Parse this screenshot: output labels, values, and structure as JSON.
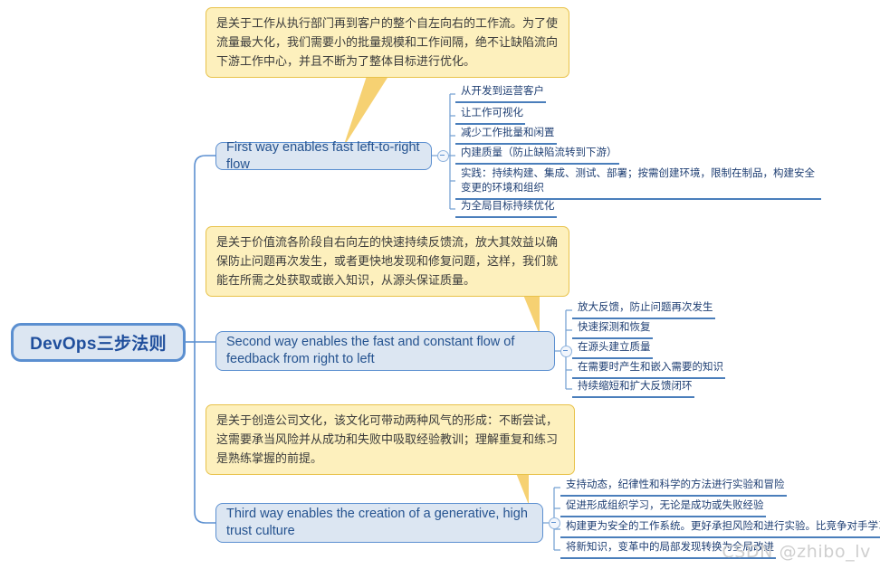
{
  "root": {
    "label": "DevOps三步法则"
  },
  "branches": [
    {
      "id": "first-way",
      "label": "First way enables fast left-to-right flow",
      "note": "是关于工作从执行部门再到客户的整个自左向右的工作流。为了使流量最大化，我们需要小的批量规模和工作间隔，绝不让缺陷流向下游工作中心，并且不断为了整体目标进行优化。",
      "leaves": [
        "从开发到运营客户",
        "让工作可视化",
        "减少工作批量和闲置",
        "内建质量（防止缺陷流转到下游）",
        "实践：持续构建、集成、测试、部署；按需创建环境，限制在制品，构建安全变更的环境和组织",
        "为全局目标持续优化"
      ]
    },
    {
      "id": "second-way",
      "label": "Second way enables the fast and constant flow of feedback from right to left",
      "note": "是关于价值流各阶段自右向左的快速持续反馈流，放大其效益以确保防止问题再次发生，或者更快地发现和修复问题，这样，我们就能在所需之处获取或嵌入知识，从源头保证质量。",
      "leaves": [
        "放大反馈，防止问题再次发生",
        "快速探测和恢复",
        "在源头建立质量",
        "在需要时产生和嵌入需要的知识",
        "持续缩短和扩大反馈闭环"
      ]
    },
    {
      "id": "third-way",
      "label": "Third way enables the creation of a generative, high trust culture",
      "note": "是关于创造公司文化，该文化可带动两种风气的形成：不断尝试，这需要承当风险并从成功和失败中吸取经验教训；理解重复和练习是熟练掌握的前提。",
      "leaves": [
        "支持动态，纪律性和科学的方法进行实验和冒险",
        "促进形成组织学习，无论是成功或失败经验",
        "构建更为安全的工作系统。更好承担风险和进行实验。比竞争对手学习更快",
        "将新知识，变革中的局部发现转换为全局改进"
      ]
    }
  ],
  "watermark": "CSDN @zhibo_lv",
  "colors": {
    "node_fill": "#dce6f2",
    "node_border": "#5b8fd0",
    "node_text": "#24528f",
    "note_fill": "#fdf0bd",
    "note_border": "#e8c24a",
    "leaf_underline": "#4a7ebb",
    "root_text": "#1f4e9c"
  }
}
